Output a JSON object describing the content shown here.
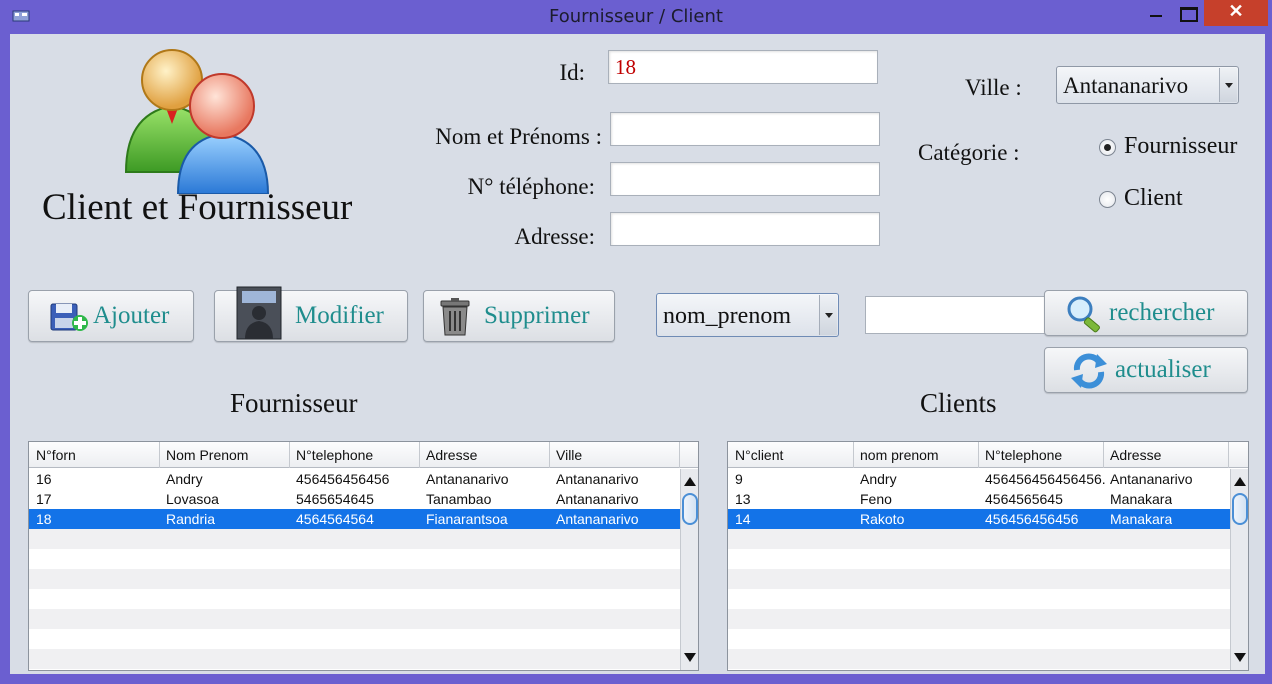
{
  "window": {
    "title": "Fournisseur / Client",
    "close_glyph": "✕"
  },
  "header": {
    "app_title": "Client et Fournisseur",
    "logo_icon": "users-icon"
  },
  "form": {
    "id_label": "Id:",
    "id_value": "18",
    "name_label": "Nom et Prénoms :",
    "name_value": "",
    "phone_label": "N° téléphone:",
    "phone_value": "",
    "address_label": "Adresse:",
    "address_value": "",
    "ville_label": "Ville :",
    "ville_value": "Antananarivo",
    "categorie_label": "Catégorie :",
    "categorie_options": [
      "Fournisseur",
      "Client"
    ],
    "categorie_selected": "Fournisseur"
  },
  "toolbar": {
    "add_label": "Ajouter",
    "edit_label": "Modifier",
    "delete_label": "Supprimer",
    "search_field_value": "nom_prenom",
    "search_text": "",
    "search_label": "rechercher",
    "refresh_label": "actualiser"
  },
  "fournisseur_table": {
    "title": "Fournisseur",
    "columns": [
      "N°forn",
      "Nom Prenom",
      "N°telephone",
      "Adresse",
      "Ville"
    ],
    "rows": [
      [
        "16",
        "Andry",
        "456456456456",
        "Antananarivo",
        "Antananarivo"
      ],
      [
        "17",
        "Lovasoa",
        "5465654645",
        "Tanambao",
        "Antananarivo"
      ],
      [
        "18",
        "Randria",
        "4564564564",
        "Fianarantsoa",
        "Antananarivo"
      ]
    ],
    "selected_row": 2
  },
  "client_table": {
    "title": "Clients",
    "columns": [
      "N°client",
      "nom prenom",
      "N°telephone",
      "Adresse"
    ],
    "rows": [
      [
        "9",
        "Andry",
        "456456456456456...",
        "Antananarivo"
      ],
      [
        "13",
        "Feno",
        "4564565645",
        "Manakara"
      ],
      [
        "14",
        "Rakoto",
        "456456456456",
        "Manakara"
      ]
    ],
    "selected_row": 2
  },
  "colors": {
    "title_bar": "#6b5fd0",
    "panel": "#d8dde6",
    "selection": "#1373e8",
    "button_text": "#1f8d8d",
    "id_text": "#c00000"
  }
}
